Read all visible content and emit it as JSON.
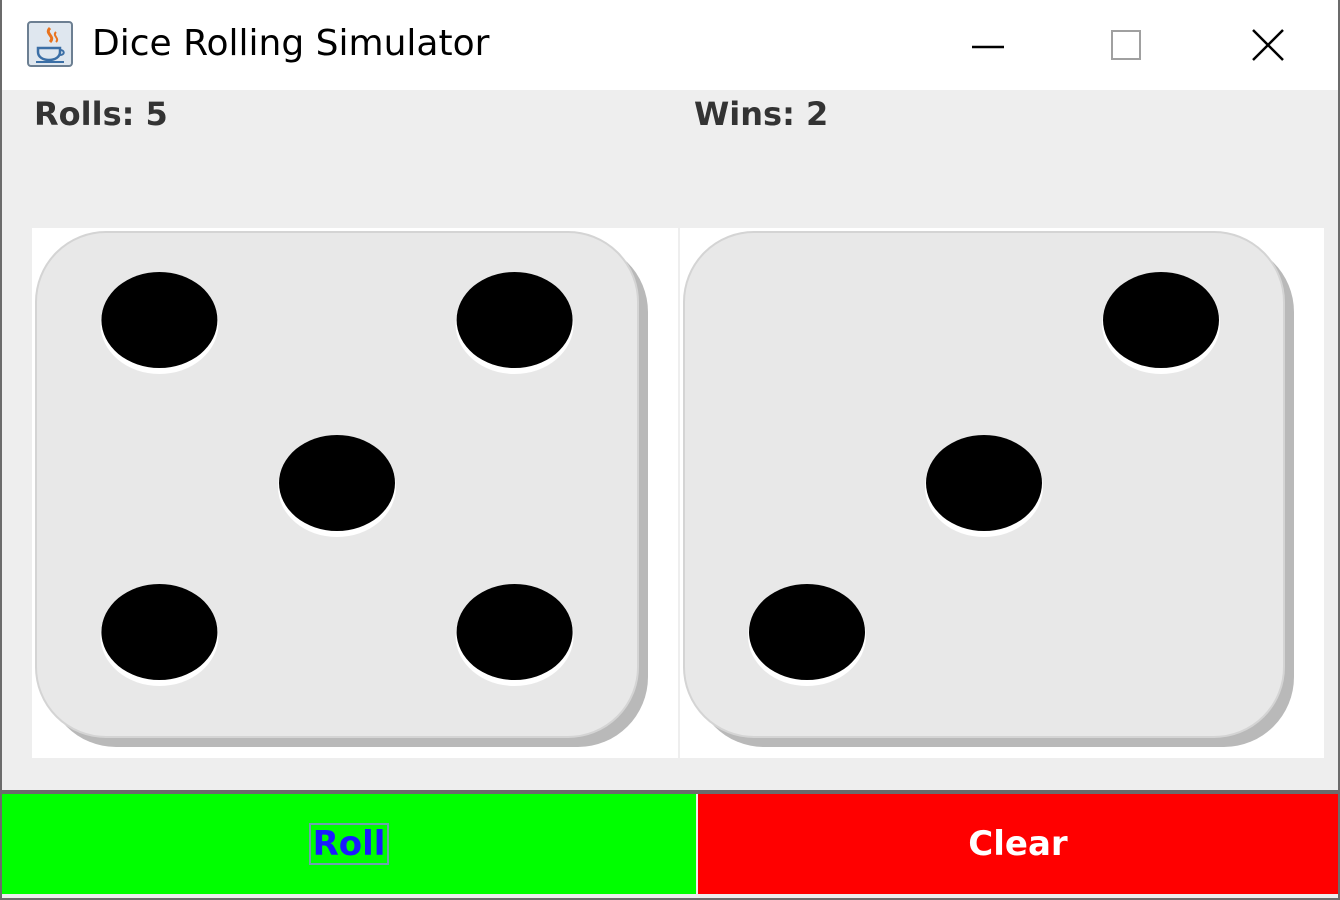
{
  "window": {
    "title": "Dice Rolling Simulator",
    "icon": "java-icon",
    "controls": [
      "minimize-icon",
      "maximize-icon",
      "close-icon"
    ]
  },
  "stats": {
    "rolls_label": "Rolls: 5",
    "wins_label": "Wins: 2"
  },
  "dice": [
    {
      "value": 5
    },
    {
      "value": 3
    }
  ],
  "buttons": {
    "roll_label": "Roll",
    "clear_label": "Clear"
  },
  "colors": {
    "roll_bg": "#00ff00",
    "roll_text": "#1a1aff",
    "clear_bg": "#ff0000",
    "clear_text": "#ffffff",
    "pip": "#000000",
    "die_face": "#e8e8e8"
  }
}
